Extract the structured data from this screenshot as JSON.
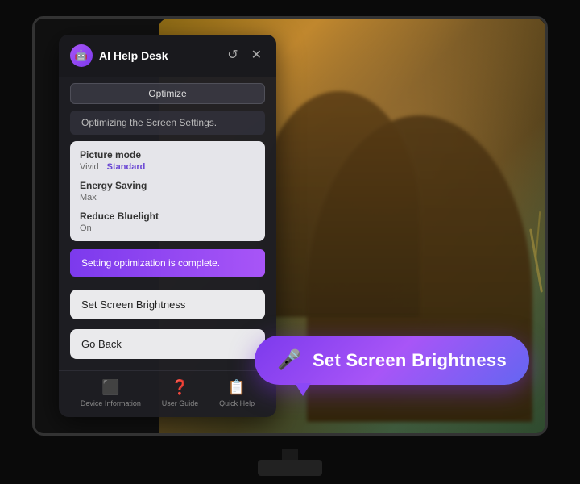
{
  "app": {
    "title": "AI Help Desk",
    "optimize_button": "Optimize",
    "status_text": "Optimizing the Screen Settings.",
    "completion_text": "Setting optimization is complete.",
    "ai_icon": "🤖"
  },
  "settings": {
    "picture_mode": {
      "label": "Picture mode",
      "value_inactive": "Vivid",
      "value_active": "Standard"
    },
    "energy_saving": {
      "label": "Energy Saving",
      "value": "Max"
    },
    "reduce_bluelight": {
      "label": "Reduce Bluelight",
      "value": "On"
    }
  },
  "actions": {
    "set_brightness": "Set Screen Brightness",
    "go_back": "Go Back"
  },
  "footer": {
    "device_info": "Device Information",
    "user_guide": "User Guide",
    "quick_help": "Quick Help"
  },
  "voice_command": {
    "text": "Set Screen Brightness"
  },
  "controls": {
    "refresh_icon": "↺",
    "close_icon": "✕"
  }
}
